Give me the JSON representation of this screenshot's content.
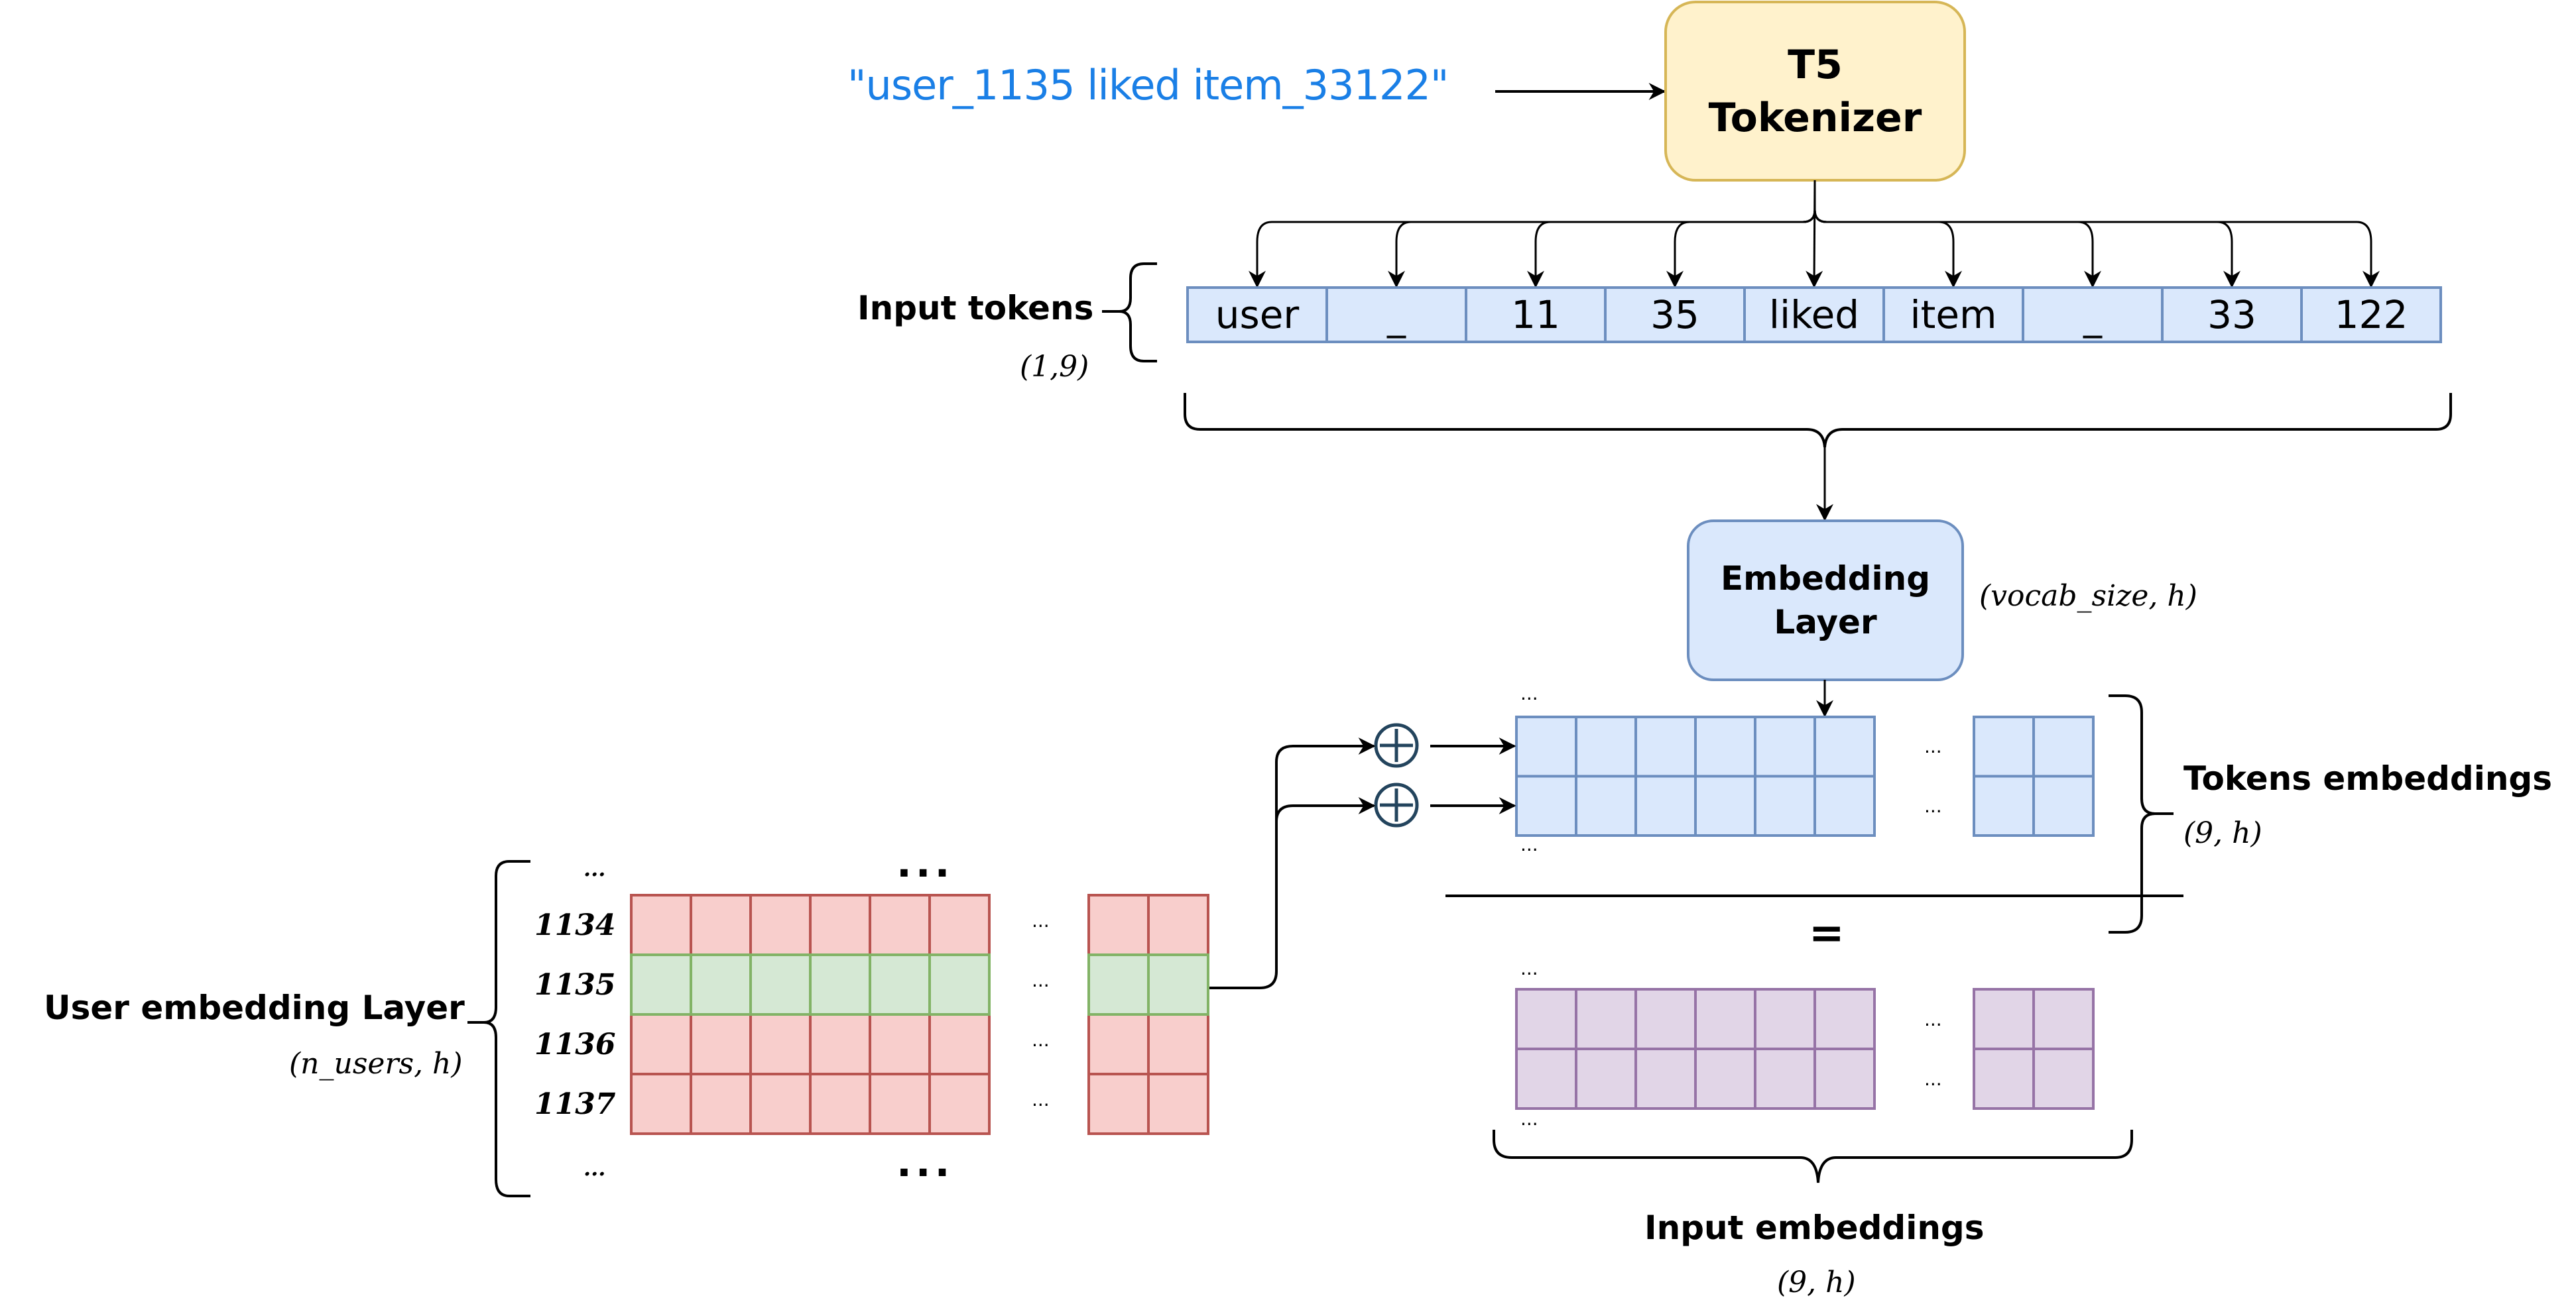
{
  "input_sentence": "\"user_1135 liked item_33122\"",
  "tokenizer": {
    "line1": "T5",
    "line2": "Tokenizer"
  },
  "input_tokens": {
    "label": "Input tokens",
    "shape": "(1,9)",
    "tokens": [
      "user",
      "_",
      "11",
      "35",
      "liked",
      "item",
      "_",
      "33",
      "122"
    ]
  },
  "embedding_layer": {
    "line1": "Embedding",
    "line2": "Layer",
    "shape": "(vocab_size, h)"
  },
  "tokens_embeddings": {
    "label": "Tokens embeddings",
    "shape": "(9, h)",
    "ellipsis": "..."
  },
  "user_embedding_layer": {
    "label": "User embedding Layer",
    "shape": "(n_users, h)",
    "row_ids": [
      "1134",
      "1135",
      "1136",
      "1137"
    ],
    "highlighted_row": "1135",
    "ellipsis": "...",
    "ellipsis_big": "..."
  },
  "operators": {
    "plus": "+",
    "equals": "="
  },
  "input_embeddings": {
    "label": "Input embeddings",
    "shape": "(9, h)",
    "ellipsis": "..."
  },
  "colors": {
    "sentence_text": "#1a7fe6",
    "tokenizer_fill": "#fff2cc",
    "tokenizer_stroke": "#d6b656",
    "blue_fill": "#dae8fc",
    "blue_stroke": "#6c8ebf",
    "red_fill": "#f8cecc",
    "red_stroke": "#b85450",
    "green_fill": "#d5e8d4",
    "green_stroke": "#82b366",
    "purple_fill": "#e1d5e7",
    "purple_stroke": "#9673a6",
    "plus_stroke": "#23445d"
  }
}
